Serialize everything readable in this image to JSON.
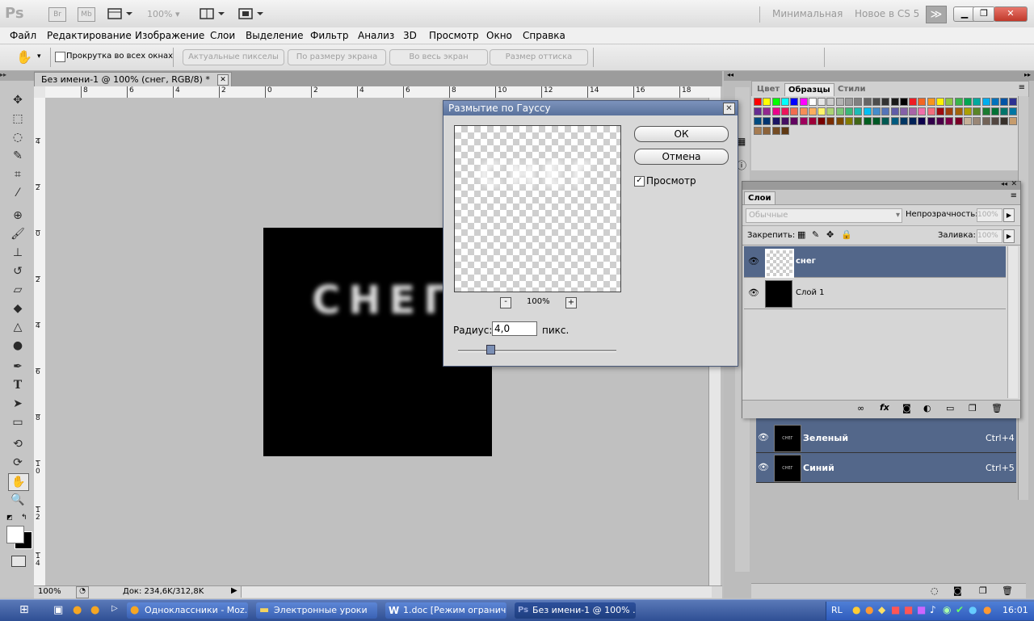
{
  "app": {
    "logo": "Ps",
    "br": "Br",
    "mb": "Mb",
    "zoom": "100%",
    "workspace_min": "Минимальная",
    "workspace_new": "Новое в CS 5"
  },
  "menu": [
    "Файл",
    "Редактирование",
    "Изображение",
    "Слои",
    "Выделение",
    "Фильтр",
    "Анализ",
    "3D",
    "Просмотр",
    "Окно",
    "Справка"
  ],
  "options": {
    "scroll_all": "Прокрутка во всех окнах",
    "actual_pixels": "Актуальные пикселы",
    "fit_screen": "По размеру экрана",
    "fill_screen": "Во весь экран",
    "print_size": "Размер оттиска"
  },
  "document": {
    "tab_title": "Без имени-1 @ 100% (снег, RGB/8) *",
    "image_text": "СНЕГ"
  },
  "ruler": {
    "h": [
      "8",
      "6",
      "4",
      "2",
      "0",
      "2",
      "4",
      "6",
      "8",
      "10",
      "12",
      "14",
      "16",
      "18"
    ],
    "v": [
      "4",
      "2",
      "0",
      "2",
      "4",
      "6",
      "8",
      "1\n0",
      "1\n2",
      "1\n4"
    ]
  },
  "status": {
    "zoom": "100%",
    "doc": "Док: 234,6K/312,8K"
  },
  "dialog": {
    "title": "Размытие по Гауссу",
    "ok": "ОК",
    "cancel": "Отмена",
    "preview_label": "Просмотр",
    "preview_checked": true,
    "zoom": "100%",
    "zoom_minus": "-",
    "zoom_plus": "+",
    "radius_label": "Радиус:",
    "radius_value": "4,0",
    "radius_unit": "пикс.",
    "slider_fraction": 0.2
  },
  "swatches_panel": {
    "tabs": [
      "Цвет",
      "Образцы",
      "Стили"
    ],
    "active_tab": "Образцы",
    "colors": [
      "#ff0000",
      "#ffff00",
      "#00ff00",
      "#00ffff",
      "#0000ff",
      "#ff00ff",
      "#ffffff",
      "#e6e6e6",
      "#cccccc",
      "#b3b3b3",
      "#999999",
      "#808080",
      "#666666",
      "#4d4d4d",
      "#333333",
      "#1a1a1a",
      "#000000",
      "#ee1c24",
      "#f26522",
      "#f7941d",
      "#fff200",
      "#8dc63f",
      "#39b54a",
      "#00a651",
      "#00a99d",
      "#00aeef",
      "#0072bc",
      "#0054a6",
      "#2e3192",
      "#662d91",
      "#92278f",
      "#ec008c",
      "#ed145b",
      "#f26c4f",
      "#f68e56",
      "#fbaf5d",
      "#fff568",
      "#acd373",
      "#7cc576",
      "#3cb878",
      "#1cbbb4",
      "#00bff3",
      "#448ccb",
      "#5574b9",
      "#605ca8",
      "#8560a8",
      "#a864a8",
      "#f06eaa",
      "#f26d7d",
      "#9e0b0f",
      "#a0410d",
      "#a36209",
      "#aba000",
      "#598527",
      "#1a7b30",
      "#007236",
      "#00746b",
      "#0076a3",
      "#004b80",
      "#003471",
      "#1b1464",
      "#440e62",
      "#630460",
      "#9e005d",
      "#9e0039",
      "#790000",
      "#7b2e00",
      "#7d4900",
      "#827b00",
      "#406618",
      "#005e20",
      "#005826",
      "#005952",
      "#005b7f",
      "#003663",
      "#002157",
      "#0d004c",
      "#32004b",
      "#4b0049",
      "#7b0046",
      "#7a0026",
      "#c7b299",
      "#998675",
      "#736357",
      "#534741",
      "#37302a",
      "#c69c6d",
      "#a67c52",
      "#8c6239",
      "#754c24",
      "#603913"
    ],
    "used_colors_note": ""
  },
  "layers_panel": {
    "title": "Слои",
    "blend_mode": "Обычные",
    "opacity_label": "Непрозрачность:",
    "opacity_value": "100%",
    "lock_label": "Закрепить:",
    "fill_label": "Заливка:",
    "fill_value": "100%",
    "layers": [
      {
        "name": "снег",
        "selected": true,
        "transparent": true
      },
      {
        "name": "Слой 1",
        "selected": false,
        "transparent": false
      }
    ]
  },
  "channels": [
    {
      "name": "Зеленый",
      "shortcut": "Ctrl+4"
    },
    {
      "name": "Синий",
      "shortcut": "Ctrl+5"
    }
  ],
  "taskbar": {
    "tasks": [
      {
        "label": "Одноклассники - Moz...",
        "active": false
      },
      {
        "label": "Электронные уроки",
        "active": false
      },
      {
        "label": "1.doc [Режим огранич...",
        "active": false
      },
      {
        "label": "Без имени-1 @ 100% ...",
        "active": true
      }
    ],
    "lang": "RL",
    "time": "16:01"
  }
}
